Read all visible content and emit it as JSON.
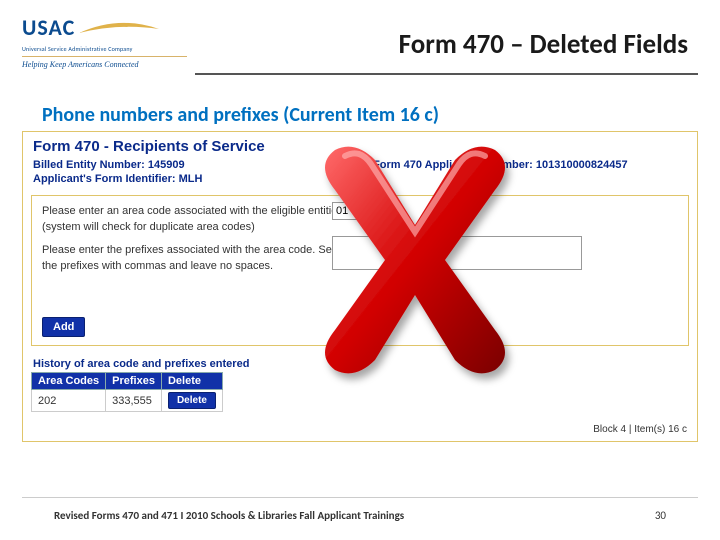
{
  "logo": {
    "letters": "USAC",
    "sub1": "Universal Service Administrative Company",
    "sub2": "Helping Keep Americans Connected"
  },
  "title": "Form 470 – Deleted Fields",
  "subhead": "Phone numbers and prefixes (Current Item 16 c)",
  "form": {
    "panel_title": "Form 470 - Recipients of Service",
    "billed_label": "Billed Entity Number: 145909",
    "applicant_label": "Applicant's Form Identifier: MLH",
    "app_number_label": "Form 470 Application Number: 101310000824457",
    "line1": "Please enter an area code associated with the eligible entities",
    "line2": "(system will check for duplicate area codes)",
    "line3": "Please enter the prefixes associated with the area code. Separate",
    "line4": "the prefixes with commas and leave no spaces.",
    "areacode_value": "01",
    "add_label": "Add",
    "history_title": "History of area code and prefixes entered",
    "columns": {
      "c1": "Area Codes",
      "c2": "Prefixes",
      "c3": "Delete"
    },
    "row": {
      "area": "202",
      "prefixes": "333,555",
      "delete_label": "Delete"
    },
    "block_info": "Block 4 | Item(s) 16 c"
  },
  "footer": {
    "left": "Revised Forms 470 and 471 I 2010 Schools & Libraries Fall Applicant Trainings",
    "page": "30"
  }
}
